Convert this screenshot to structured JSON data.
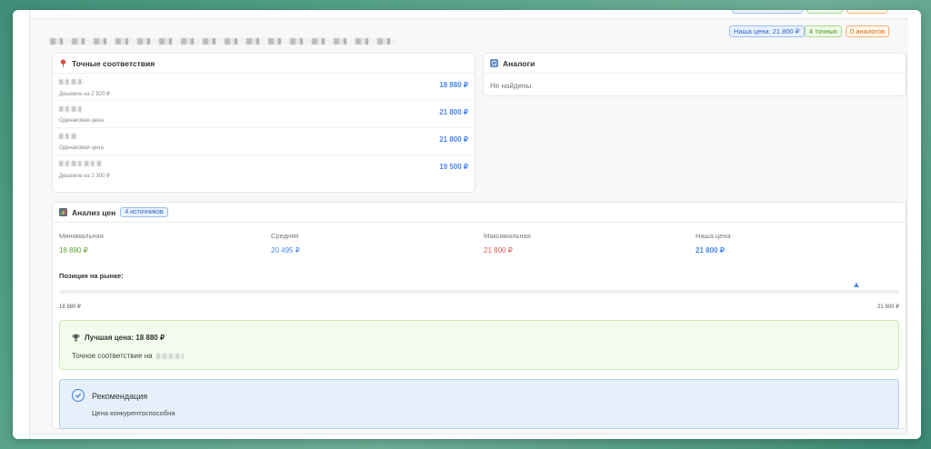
{
  "header": {
    "badges": {
      "our_price": "Наша цена: 21 800 ₽",
      "exact": "4 точных",
      "analogs": "0 аналогов"
    }
  },
  "exact_matches": {
    "title": "Точные соответствия",
    "icon": "pin-icon",
    "items": [
      {
        "price": "18 880 ₽",
        "note": "Дешевле на 2 920 ₽"
      },
      {
        "price": "21 800 ₽",
        "note": "Одинаковая цена"
      },
      {
        "price": "21 800 ₽",
        "note": "Одинаковая цена"
      },
      {
        "price": "19 500 ₽",
        "note": "Дешевле на 2 300 ₽"
      }
    ]
  },
  "analogs": {
    "title": "Аналоги",
    "icon": "refresh-icon",
    "empty_text": "Не найдены"
  },
  "analysis": {
    "title": "Анализ цен",
    "icon": "chart-icon",
    "sources_badge": "4 источников",
    "stats": [
      {
        "label": "Минимальная",
        "value": "18 880 ₽",
        "color": "#5aa832"
      },
      {
        "label": "Средняя",
        "value": "20 495 ₽",
        "color": "#4a86e8"
      },
      {
        "label": "Максимальная",
        "value": "21 800 ₽",
        "color": "#e05a4a"
      },
      {
        "label": "Наша цена",
        "value": "21 800 ₽",
        "color": "#4a86e8"
      }
    ],
    "position_label": "Позиция на рынке:",
    "range_min": "18 880 ₽",
    "range_max": "21 800 ₽",
    "position_fraction": 0.95
  },
  "best_price": {
    "icon": "trophy-icon",
    "title": "Лучшая цена: 18 880 ₽",
    "subtitle": "Точное соответствие на"
  },
  "recommendation": {
    "icon": "check-circle-icon",
    "title": "Рекомендация",
    "text": "Цена конкурентоспособна"
  }
}
